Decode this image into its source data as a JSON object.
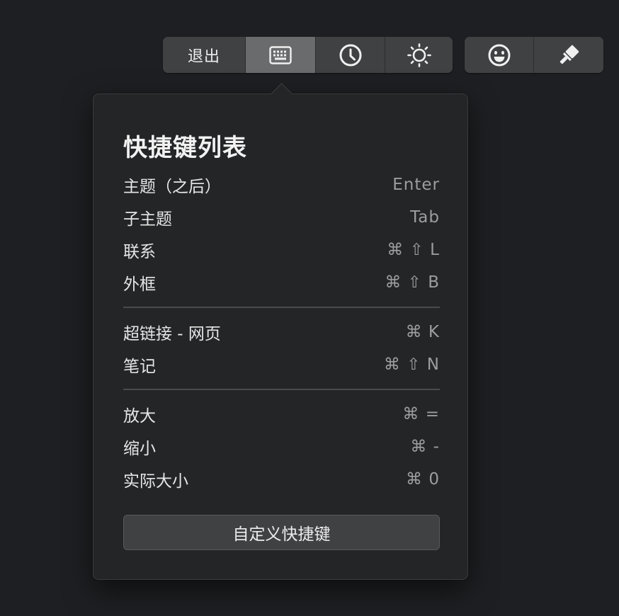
{
  "toolbar": {
    "exit_label": "退出",
    "buttons": [
      {
        "name": "keyboard",
        "icon": "keyboard-icon",
        "active": true
      },
      {
        "name": "history",
        "icon": "clock-icon",
        "active": false
      },
      {
        "name": "theme",
        "icon": "sun-icon",
        "active": false
      }
    ],
    "right_buttons": [
      {
        "name": "emoji",
        "icon": "smiley-icon"
      },
      {
        "name": "format-painter",
        "icon": "brush-icon"
      }
    ]
  },
  "popover": {
    "title": "快捷键列表",
    "groups": [
      [
        {
          "label": "主题（之后）",
          "keys": "Enter"
        },
        {
          "label": "子主题",
          "keys": "Tab"
        },
        {
          "label": "联系",
          "keys": "⌘ ⇧ L"
        },
        {
          "label": "外框",
          "keys": "⌘ ⇧ B"
        }
      ],
      [
        {
          "label": "超链接 - 网页",
          "keys": "⌘ K"
        },
        {
          "label": "笔记",
          "keys": "⌘ ⇧ N"
        }
      ],
      [
        {
          "label": "放大",
          "keys": "⌘ ="
        },
        {
          "label": "缩小",
          "keys": "⌘ -"
        },
        {
          "label": "实际大小",
          "keys": "⌘ 0"
        }
      ]
    ],
    "custom_button_label": "自定义快捷键"
  },
  "colors": {
    "background": "#1e1f22",
    "panel": "#242527",
    "toolbar": "#404142",
    "active": "#6a6b6c",
    "text": "#e6e6e6",
    "muted": "#9c9d9f"
  }
}
